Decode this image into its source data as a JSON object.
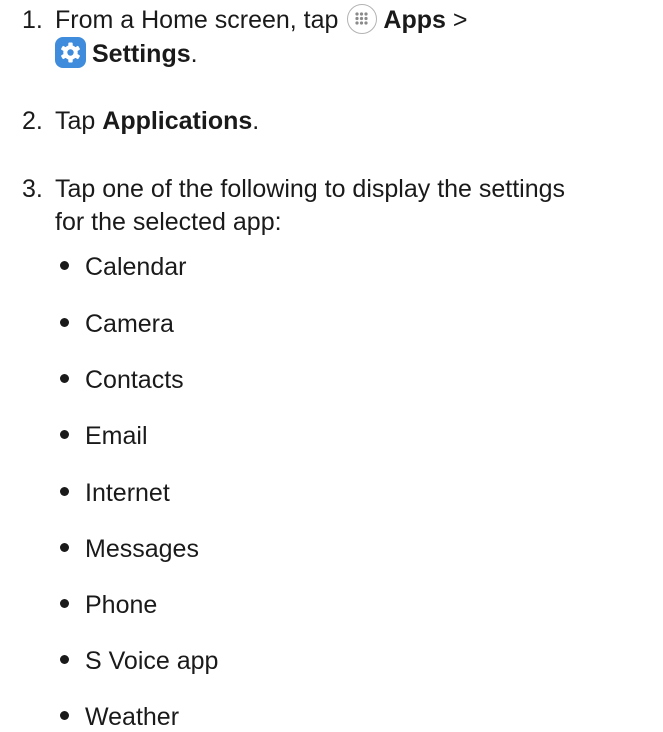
{
  "steps": [
    {
      "number": "1.",
      "pre": "From a Home screen, tap",
      "apps_label": "Apps",
      "gt": ">",
      "settings_label": "Settings",
      "end": "."
    },
    {
      "number": "2.",
      "pre": "Tap",
      "bold": "Applications",
      "end": "."
    },
    {
      "number": "3.",
      "line1": "Tap one of the following to display the settings",
      "line2": "for the selected app:"
    }
  ],
  "apps": [
    "Calendar",
    "Camera",
    "Contacts",
    "Email",
    "Internet",
    "Messages",
    "Phone",
    "S Voice app",
    "Weather"
  ],
  "icons": {
    "apps": "apps-grid-icon",
    "settings": "settings-gear-icon"
  },
  "colors": {
    "settings_icon_bg": "#3f8bdc",
    "text": "#1a1a1a"
  }
}
